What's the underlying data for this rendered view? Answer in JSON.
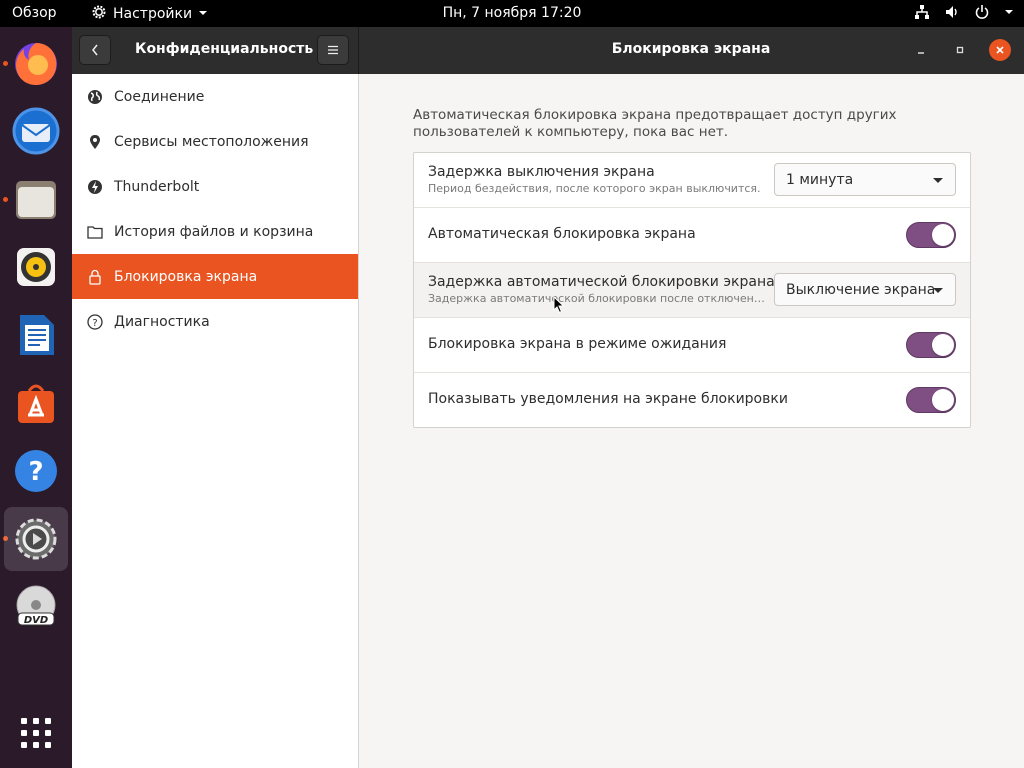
{
  "topbar": {
    "overview": "Обзор",
    "app_menu": "Настройки",
    "clock": "Пн, 7 ноября  17:20"
  },
  "dock": {
    "items": [
      "firefox-icon",
      "thunderbird-icon",
      "files-icon",
      "rhythmbox-icon",
      "libreoffice-writer-icon",
      "software-icon",
      "help-icon",
      "settings-icon",
      "dvd-icon",
      "show-apps-icon"
    ]
  },
  "header": {
    "pane_title": "Конфиденциальность",
    "window_title": "Блокировка экрана"
  },
  "sidebar": {
    "items": [
      {
        "label": "Соединение",
        "icon": "globe-icon"
      },
      {
        "label": "Сервисы местоположения",
        "icon": "location-pin-icon"
      },
      {
        "label": "Thunderbolt",
        "icon": "thunderbolt-icon"
      },
      {
        "label": "История файлов и корзина",
        "icon": "folder-icon"
      },
      {
        "label": "Блокировка экрана",
        "icon": "lock-icon",
        "selected": true
      },
      {
        "label": "Диагностика",
        "icon": "help-circle-icon"
      }
    ]
  },
  "content": {
    "description": "Автоматическая блокировка экрана предотвращает доступ других пользователей к компьютеру, пока вас нет.",
    "rows": [
      {
        "label": "Задержка выключения экрана",
        "sub": "Период бездействия, после которого экран выключится.",
        "control": "combo",
        "value": "1 минута"
      },
      {
        "label": "Автоматическая блокировка экрана",
        "control": "toggle",
        "on": true
      },
      {
        "label": "Задержка автоматической блокировки экрана",
        "sub": "Задержка автоматической блокировки после отключения…",
        "control": "combo",
        "value": "Выключение экрана"
      },
      {
        "label": "Блокировка экрана в режиме ожидания",
        "control": "toggle",
        "on": true
      },
      {
        "label": "Показывать уведомления на экране блокировки",
        "control": "toggle",
        "on": true
      }
    ]
  },
  "colors": {
    "accent": "#e95420",
    "toggle_on": "#7f4f84",
    "topbar": "#000000",
    "dock": "#2b1a2a",
    "headerbar": "#2d2d2d"
  }
}
